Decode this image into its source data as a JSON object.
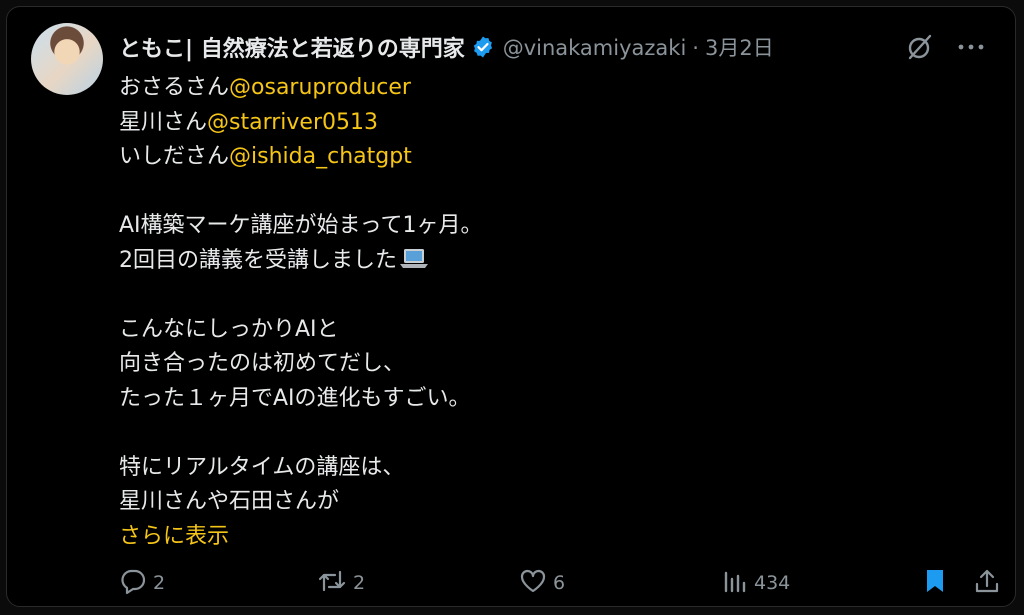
{
  "author": {
    "display_name": "ともこ| 自然療法と若返りの専門家",
    "handle": "@vinakamiyazaki",
    "separator": "·",
    "date": "3月2日"
  },
  "tweet": {
    "lines": [
      {
        "text": "おさるさん",
        "mention": "@osaruproducer"
      },
      {
        "text": "星川さん",
        "mention": "@starriver0513"
      },
      {
        "text": "いしださん",
        "mention": "@ishida_chatgpt"
      },
      {
        "text": "",
        "mention": ""
      },
      {
        "text": "AI構築マーケ講座が始まって1ヶ月。",
        "mention": ""
      },
      {
        "text": "2回目の講義を受講しました",
        "mention": ""
      },
      {
        "text": "",
        "mention": ""
      },
      {
        "text": "こんなにしっかりAIと",
        "mention": ""
      },
      {
        "text": "向き合ったのは初めてだし、",
        "mention": ""
      },
      {
        "text": "たった１ヶ月でAIの進化もすごい。",
        "mention": ""
      },
      {
        "text": "",
        "mention": ""
      },
      {
        "text": "特にリアルタイムの講座は、",
        "mention": ""
      },
      {
        "text": "星川さんや石田さんが",
        "mention": ""
      }
    ],
    "show_more": "さらに表示"
  },
  "actions": {
    "reply_count": "2",
    "retweet_count": "2",
    "like_count": "6",
    "view_count": "434"
  },
  "colors": {
    "background": "#000000",
    "text": "#e7e9ea",
    "muted": "#8b949a",
    "accent": "#f5c518",
    "verified": "#1d9bf0",
    "bookmark": "#1d9bf0"
  },
  "icons": [
    "verified-badge-icon",
    "grok-icon",
    "more-icon",
    "reply-icon",
    "retweet-icon",
    "like-icon",
    "views-icon",
    "bookmark-icon",
    "share-icon",
    "laptop-icon"
  ]
}
